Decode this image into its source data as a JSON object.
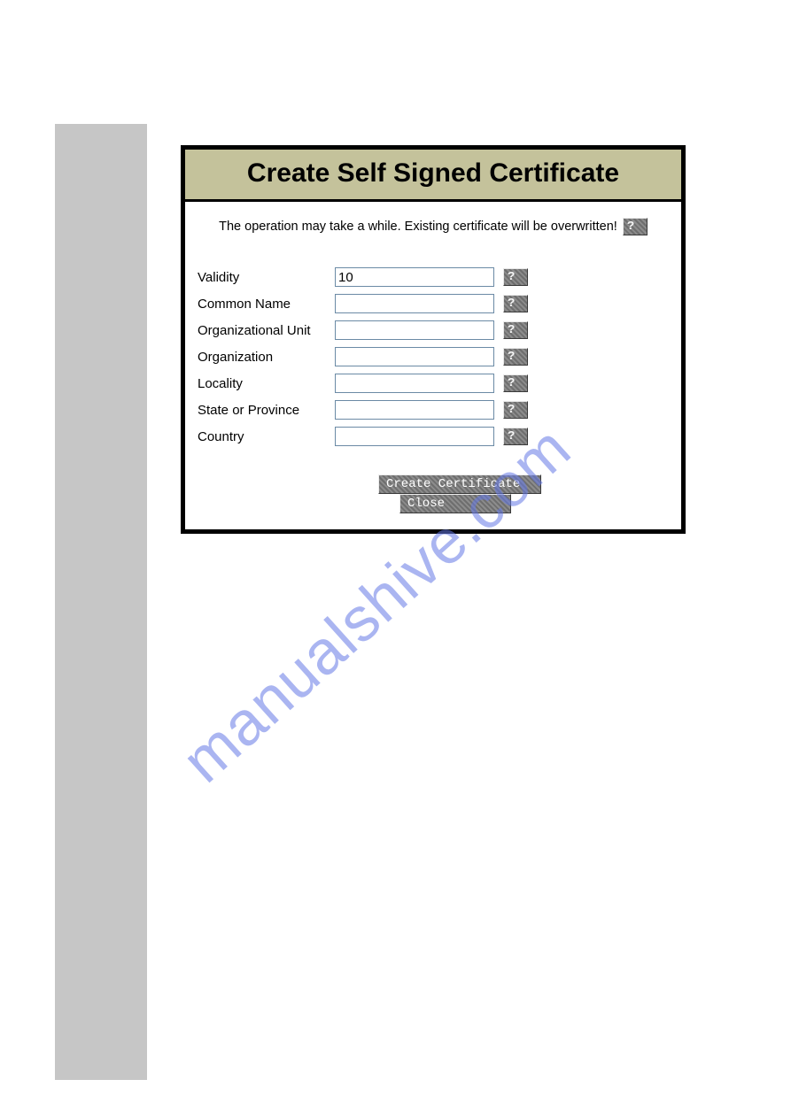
{
  "dialog": {
    "title": "Create Self Signed Certificate",
    "warning_text": "The operation may take a while. Existing certificate will be overwritten!",
    "help_glyph": "?",
    "fields": {
      "validity": {
        "label": "Validity",
        "value": "10"
      },
      "cn": {
        "label": "Common Name",
        "value": ""
      },
      "ou": {
        "label": "Organizational Unit",
        "value": ""
      },
      "org": {
        "label": "Organization",
        "value": ""
      },
      "locality": {
        "label": "Locality",
        "value": ""
      },
      "state": {
        "label": "State or Province",
        "value": ""
      },
      "country": {
        "label": "Country",
        "value": ""
      }
    },
    "buttons": {
      "create": "Create Certificate",
      "close": "Close"
    }
  },
  "watermark": "manualshive.com"
}
